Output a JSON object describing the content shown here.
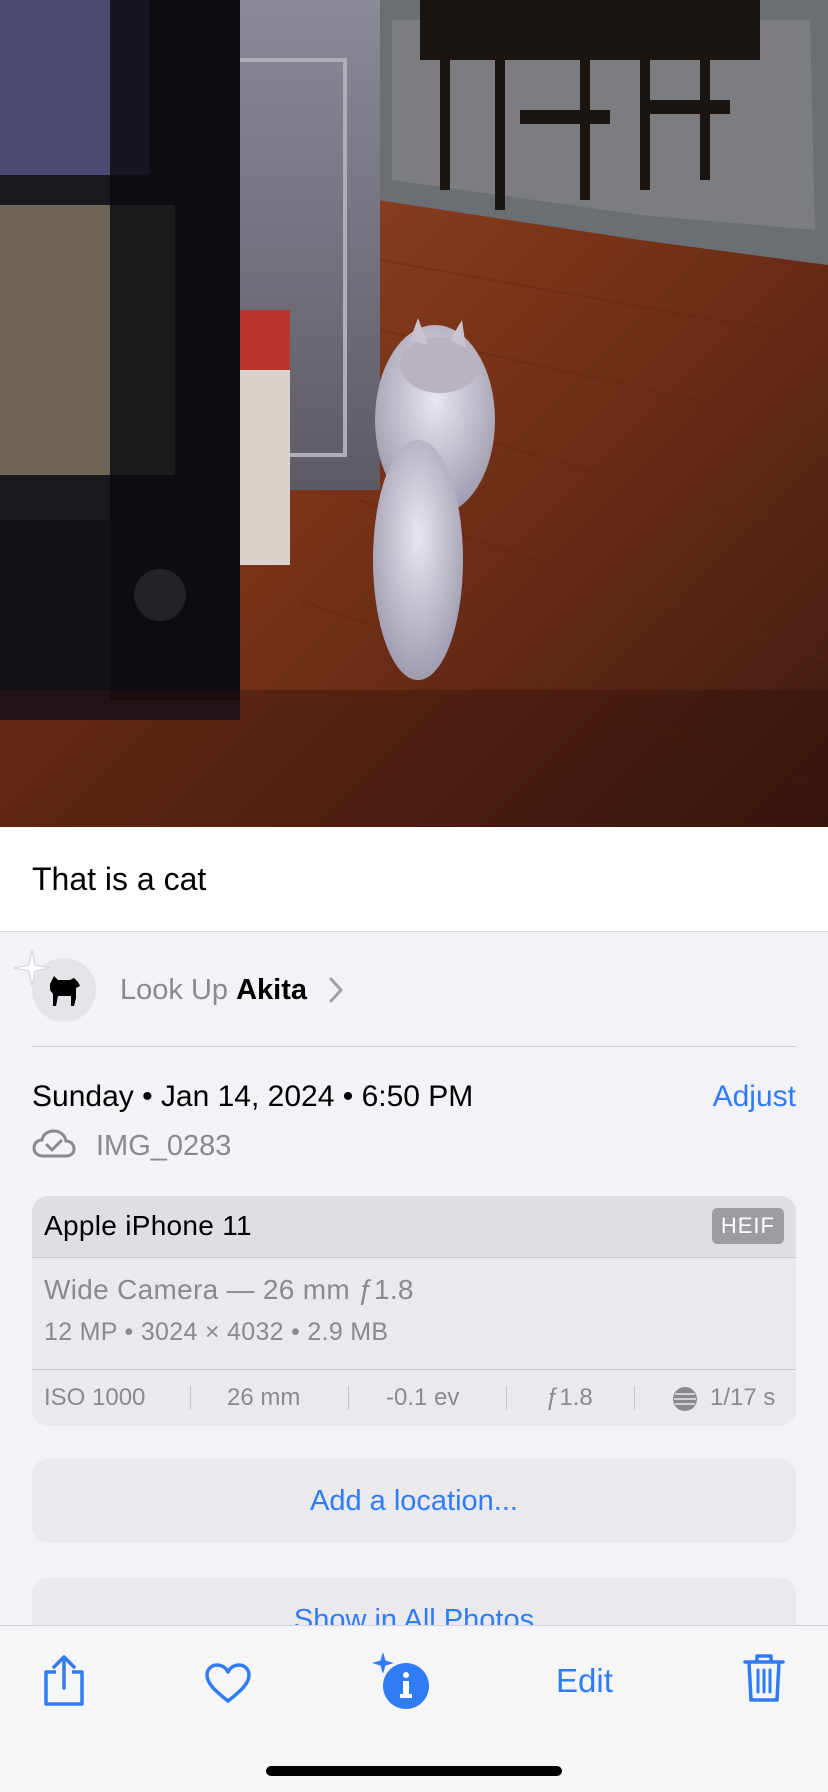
{
  "photo": {
    "description_icon": "photo-image"
  },
  "caption": "That is a cat",
  "lookup": {
    "prefix": "Look Up",
    "subject": "Akita"
  },
  "date": "Sunday • Jan 14, 2024 • 6:50 PM",
  "adjust_label": "Adjust",
  "file_name": "IMG_0283",
  "camera": {
    "device": "Apple iPhone 11",
    "format": "HEIF",
    "lens": "Wide Camera — 26 mm ƒ1.8",
    "specs": "12 MP  •  3024 × 4032  •  2.9 MB",
    "exif": {
      "iso": "ISO 1000",
      "focal": "26 mm",
      "ev": "-0.1 ev",
      "aperture": "ƒ1.8",
      "shutter": "1/17 s"
    }
  },
  "add_location_label": "Add a location...",
  "show_all_label": "Show in All Photos",
  "toolbar": {
    "edit_label": "Edit"
  },
  "colors": {
    "accent": "#2f7cf6",
    "secondary_text": "#8a8a8e"
  }
}
